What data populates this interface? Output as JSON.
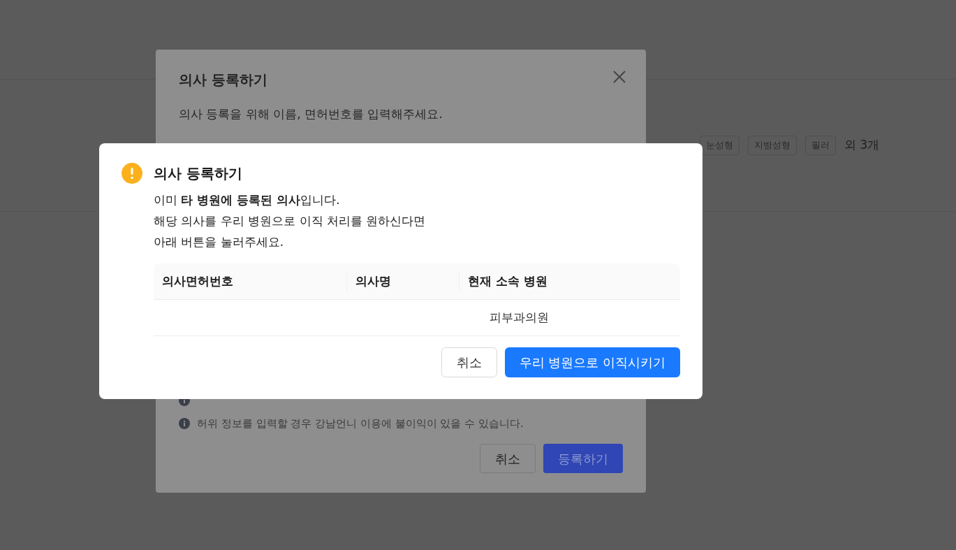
{
  "background_page": {
    "tags": [
      "눈성형",
      "지방성형",
      "필러"
    ],
    "tags_more": "외 3개"
  },
  "registration_dialog": {
    "title": "의사 등록하기",
    "description": "의사 등록을 위해 이름, 면허번호를 입력해주세요.",
    "notices": [
      "허위 정보를 입력할 경우 강남언니 이용에 불이익이 있을 수 있습니다."
    ],
    "buttons": [
      {
        "label": "취소",
        "kind": "secondary"
      },
      {
        "label": "등록하기",
        "kind": "primary"
      }
    ]
  },
  "alert_dialog": {
    "title": "의사 등록하기",
    "message_lines": [
      "이미 **타 병원에 등록된 의사**입니다.",
      "해당 의사를 우리 병원으로 이직 처리를 원하신다면",
      "아래 버튼을 눌러주세요."
    ],
    "table": {
      "columns": [
        "의사면허번호",
        "의사명",
        "현재 소속 병원"
      ],
      "rows": [
        {
          "current_hospital": "피부과의원"
        }
      ]
    },
    "buttons": [
      {
        "label": "취소",
        "kind": "secondary"
      },
      {
        "label": "우리 병원으로 이직시키기",
        "kind": "primary"
      }
    ]
  }
}
